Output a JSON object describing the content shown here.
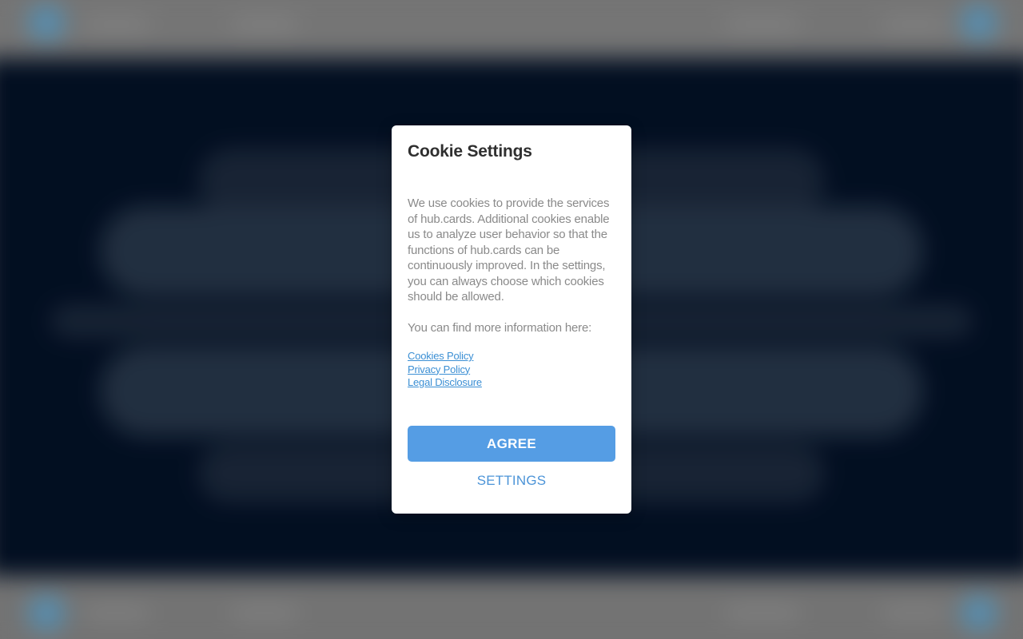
{
  "cookie_modal": {
    "title": "Cookie Settings",
    "description": "We use cookies to provide the services of hub.cards. Additional cookies enable us to analyze user behavior so that the functions of hub.cards can be continuously improved. In the settings, you can always choose which cookies should be allowed.",
    "more_info": "You can find more information here:",
    "links": {
      "cookies_policy": "Cookies Policy",
      "privacy_policy": "Privacy Policy",
      "legal_disclosure": "Legal Disclosure"
    },
    "agree_label": "AGREE",
    "settings_label": "SETTINGS"
  },
  "colors": {
    "accent": "#559de4",
    "link": "#3b8fd4",
    "hero_background": "#031024"
  }
}
